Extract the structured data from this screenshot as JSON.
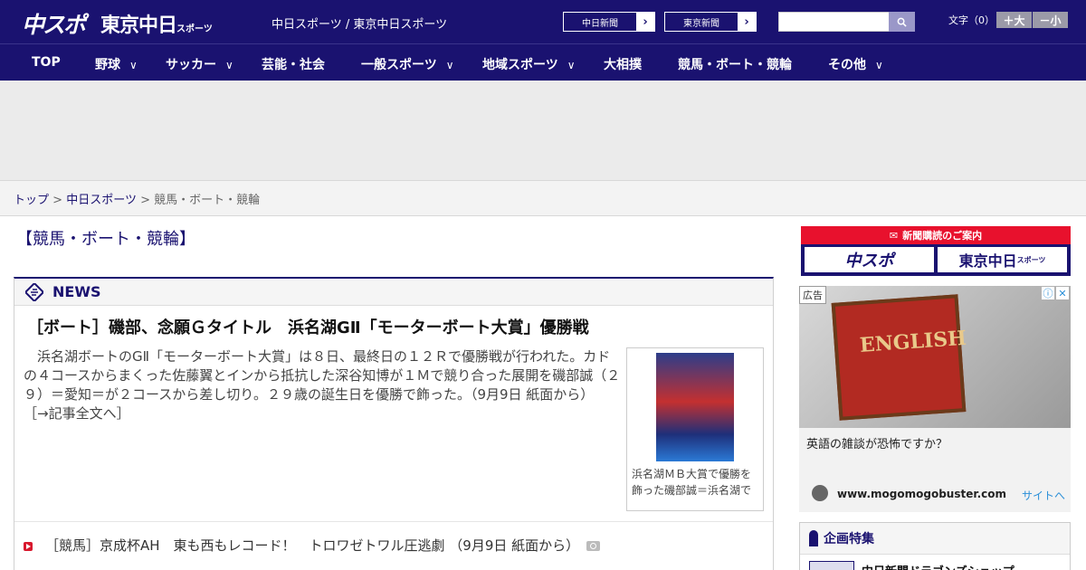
{
  "header": {
    "logo_chuspo": "中スポ",
    "logo_tokyo": "東京中日",
    "logo_tokyo_small": "スポーツ",
    "site_title": "中日スポーツ / 東京中日スポーツ",
    "site_links": [
      "中日新聞",
      "東京新聞"
    ],
    "search": {
      "value": "",
      "placeholder": ""
    },
    "font_size_label": "文字（0）",
    "font_bigger": "＋大",
    "font_smaller": "－小"
  },
  "nav": {
    "items": [
      {
        "label": "TOP",
        "has_menu": false
      },
      {
        "label": "野球",
        "has_menu": true
      },
      {
        "label": "サッカー",
        "has_menu": true
      },
      {
        "label": "芸能・社会",
        "has_menu": false
      },
      {
        "label": "一般スポーツ",
        "has_menu": true
      },
      {
        "label": "地域スポーツ",
        "has_menu": true
      },
      {
        "label": "大相撲",
        "has_menu": false
      },
      {
        "label": "競馬・ボート・競輪",
        "has_menu": false
      },
      {
        "label": "その他",
        "has_menu": true
      }
    ]
  },
  "breadcrumb": {
    "home": "トップ",
    "section": "中日スポーツ",
    "current": "競馬・ボート・競輪",
    "sep": ">"
  },
  "page_title": "【競馬・ボート・競輪】",
  "news": {
    "label": "NEWS",
    "headline": "［ボート］磯部、念願Ｇタイトル　浜名湖GⅡ「モーターボート大賞」優勝戦",
    "lead": "　浜名湖ボートのGⅡ「モーターボート大賞」は８日、最終日の１２Ｒで優勝戦が行われた。カドの４コースからまくった佐藤翼とインから抵抗した深谷知博が１Ｍで競り合った展開を磯部誠（２９）＝愛知＝が２コースから差し切り。２９歳の誕生日を優勝で飾った。（9月9日 紙面から）",
    "more": "［→記事全文へ］",
    "photo_caption": "浜名湖ＭＢ大賞で優勝を飾った磯部誠＝浜名湖で",
    "items": [
      {
        "text": "［競馬］京成杯AH　東も西もレコード！　トロワゼトワル圧逃劇 （9月9日 紙面から）",
        "has_photo": true
      }
    ]
  },
  "sidebar": {
    "subscribe_title": "新聞購読のご案内",
    "subscribe_logos": [
      "中スポ",
      "東京中日"
    ],
    "subscribe_logo_small": "スポーツ",
    "ad_tag": "広告",
    "ad_image_text": "ENGLISH",
    "ad_text": "英語の雑談が恐怖ですか？",
    "ad_domain": "www.mogomogobuster.com",
    "ad_link": "サイトへ",
    "feature_title": "企画特集",
    "feature_item": "中日新聞ドラゴンズショップ"
  }
}
